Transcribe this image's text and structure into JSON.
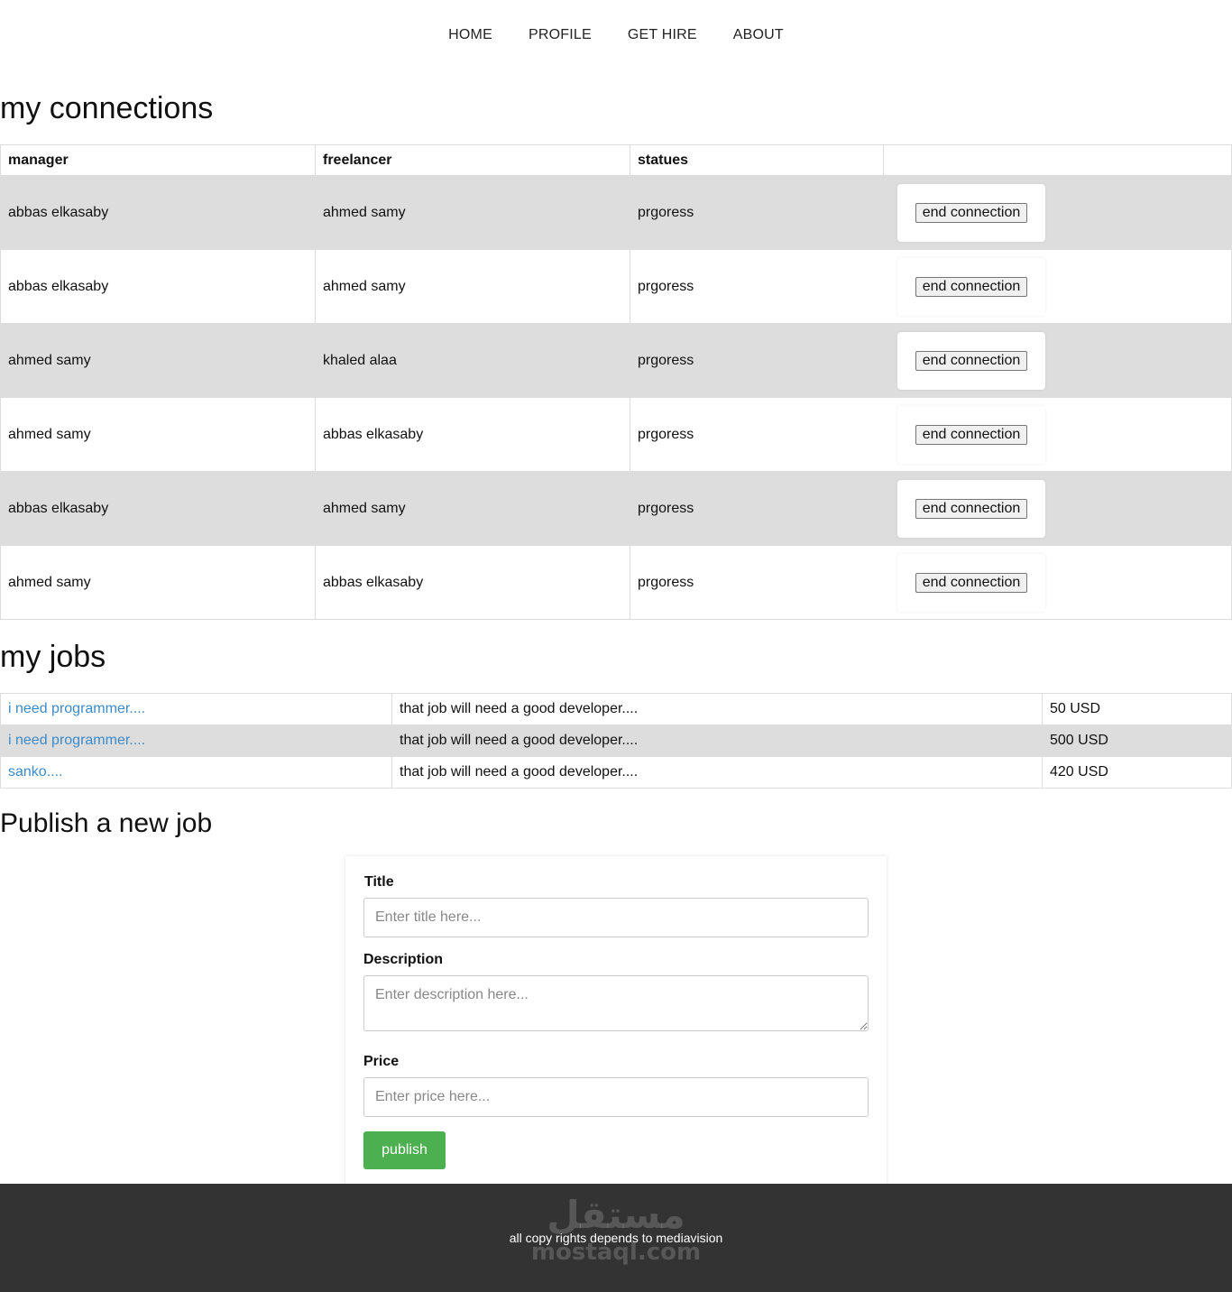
{
  "nav": {
    "home": "HOME",
    "profile": "PROFILE",
    "get_hire": "GET HIRE",
    "about": "ABOUT"
  },
  "connections": {
    "title": "my connections",
    "headers": [
      "manager",
      "freelancer",
      "statues"
    ],
    "action_label": "end connection",
    "rows": [
      {
        "manager": "abbas elkasaby",
        "freelancer": "ahmed samy",
        "status": "prgoress"
      },
      {
        "manager": "abbas elkasaby",
        "freelancer": "ahmed samy",
        "status": "prgoress"
      },
      {
        "manager": "ahmed samy",
        "freelancer": "khaled alaa",
        "status": "prgoress"
      },
      {
        "manager": "ahmed samy",
        "freelancer": "abbas elkasaby",
        "status": "prgoress"
      },
      {
        "manager": "abbas elkasaby",
        "freelancer": "ahmed samy",
        "status": "prgoress"
      },
      {
        "manager": "ahmed samy",
        "freelancer": "abbas elkasaby",
        "status": "prgoress"
      }
    ]
  },
  "jobs": {
    "title": "my jobs",
    "rows": [
      {
        "title": "i need programmer....",
        "description": "that job will need a good developer....",
        "price": "50 USD"
      },
      {
        "title": "i need programmer....",
        "description": "that job will need a good developer....",
        "price": "500 USD"
      },
      {
        "title": "sanko....",
        "description": "that job will need a good developer....",
        "price": "420 USD"
      }
    ]
  },
  "publish": {
    "title": "Publish a new job",
    "title_label": "Title",
    "title_placeholder": "Enter title here...",
    "description_label": "Description",
    "description_placeholder": "Enter description here...",
    "price_label": "Price",
    "price_placeholder": "Enter price here...",
    "button": "publish"
  },
  "footer": {
    "text": "all copy rights depends to mediavision",
    "watermark_arabic": "مستقل",
    "watermark_latin": "mostaql.com"
  },
  "colors": {
    "stripe": "#dddddd",
    "link": "#3d8bc9",
    "publish_button": "#4caf50",
    "footer_bg": "#333333"
  }
}
